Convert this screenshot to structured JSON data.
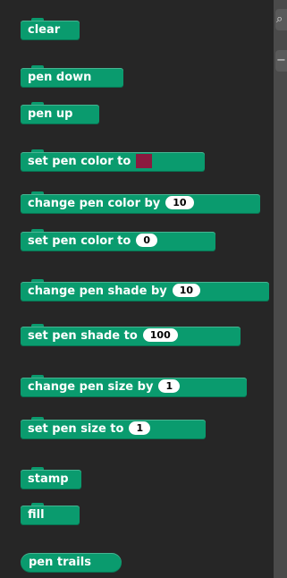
{
  "blocks": {
    "clear": "clear",
    "pen_down": "pen down",
    "pen_up": "pen up",
    "set_pen_color_to": "set pen color to",
    "change_pen_color_by": "change pen color by",
    "change_pen_color_by_value": "10",
    "set_pen_color_to_num": "set pen color to",
    "set_pen_color_to_num_value": "0",
    "change_pen_shade_by": "change pen shade by",
    "change_pen_shade_by_value": "10",
    "set_pen_shade_to": "set pen shade to",
    "set_pen_shade_to_value": "100",
    "change_pen_size_by": "change pen size by",
    "change_pen_size_by_value": "1",
    "set_pen_size_to": "set pen size to",
    "set_pen_size_to_value": "1",
    "stamp": "stamp",
    "fill": "fill",
    "pen_trails": "pen trails"
  },
  "colors": {
    "block_bg": "#0a9b6e",
    "pen_color_swatch": "#8b1a3f"
  },
  "side_buttons": {
    "search_icon": "search-icon",
    "collapse_icon": "minus-icon"
  }
}
